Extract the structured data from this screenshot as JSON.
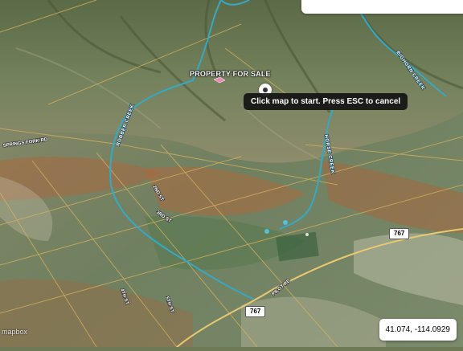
{
  "map": {
    "tooltip": "Click map to start. Press ESC to cancel",
    "property_label": "PROPERTY FOR SALE",
    "coordinates": "41.074, -114.0929",
    "attribution": "mapbox",
    "highway_shields": [
      "767",
      "767"
    ],
    "road_labels": [
      "SPRINGS FORK RD",
      "2ND ST",
      "3RD ST",
      "4TH ST",
      "5TH ST",
      "PILOT RD"
    ],
    "creek_labels": [
      "BIGHORN CREEK",
      "ROBBER CREEK",
      "HORSE CREEK"
    ],
    "colors": {
      "creek_line": "#37a8c4",
      "boundary_marker": "#e98bb8",
      "tooltip_bg": "#141414"
    }
  }
}
